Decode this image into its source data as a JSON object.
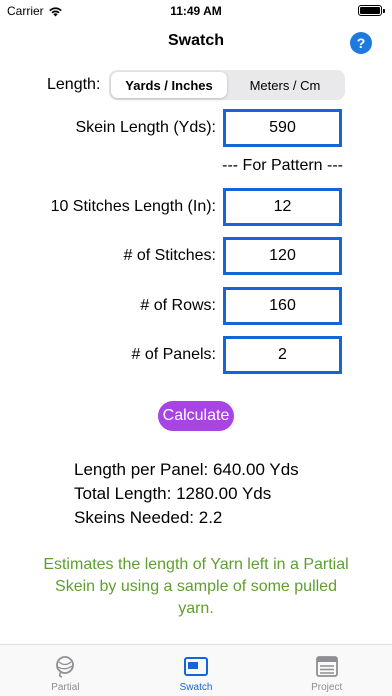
{
  "status_bar": {
    "carrier": "Carrier",
    "time": "11:49 AM"
  },
  "nav": {
    "title": "Swatch",
    "help_label": "?"
  },
  "length": {
    "label": "Length:",
    "options": [
      "Yards / Inches",
      "Meters / Cm"
    ],
    "selected": "Yards / Inches"
  },
  "fields": {
    "skein_length": {
      "label": "Skein Length (Yds):",
      "value": "590"
    },
    "section_header": "--- For Pattern ---",
    "stitches_length": {
      "label": "10 Stitches Length (In):",
      "value": "12"
    },
    "num_stitches": {
      "label": "# of Stitches:",
      "value": "120"
    },
    "num_rows": {
      "label": "# of Rows:",
      "value": "160"
    },
    "num_panels": {
      "label": "# of Panels:",
      "value": "2"
    }
  },
  "calculate_label": "Calculate",
  "results": {
    "length_per_panel": "Length per Panel: 640.00 Yds",
    "total_length": "Total Length: 1280.00 Yds",
    "skeins_needed": "Skeins Needed: 2.2"
  },
  "description": "Estimates the length of Yarn left in a Partial Skein by using a sample of some pulled yarn.",
  "tabs": [
    {
      "label": "Partial",
      "icon": "yarn-icon",
      "active": false
    },
    {
      "label": "Swatch",
      "icon": "swatch-icon",
      "active": true
    },
    {
      "label": "Project",
      "icon": "project-icon",
      "active": false
    }
  ],
  "colors": {
    "accent_blue": "#1565d8",
    "calculate_purple": "#a844e4",
    "description_green": "#5ea02e",
    "help_blue": "#1f7ae0"
  }
}
